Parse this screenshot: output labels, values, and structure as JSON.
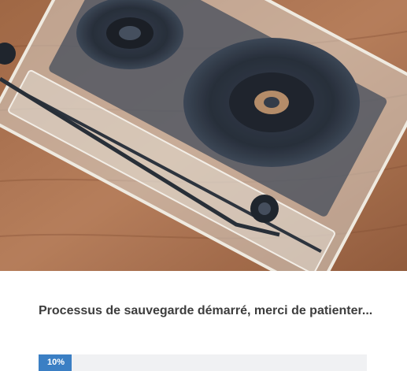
{
  "hero": {
    "image": "cassette-tape-photo-icon"
  },
  "status": {
    "message": "Processus de sauvegarde démarré, merci de patienter..."
  },
  "progress": {
    "value": 0.1,
    "label": "10%",
    "color": "#3b7fc4",
    "track_color": "#f0f1f3"
  }
}
